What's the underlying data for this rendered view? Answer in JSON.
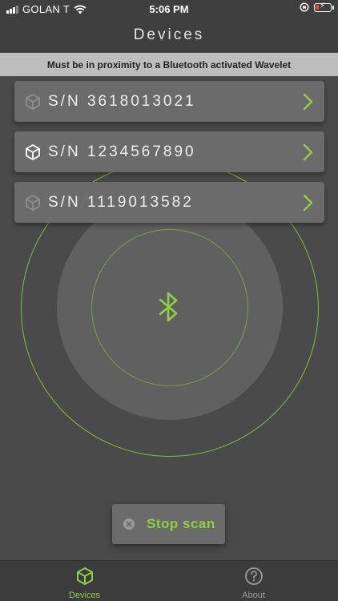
{
  "status_bar": {
    "carrier": "GOLAN T",
    "time": "5:06 PM"
  },
  "header": {
    "title": "Devices"
  },
  "notice": {
    "text": "Must be in proximity to a Bluetooth activated Wavelet"
  },
  "devices": [
    {
      "serial": "S/N  3618013021",
      "icon": "cube-icon",
      "highlighted": false
    },
    {
      "serial": "S/N  1234567890",
      "icon": "cube-icon",
      "highlighted": true
    },
    {
      "serial": "S/N  1119013582",
      "icon": "cube-icon",
      "highlighted": false
    }
  ],
  "scan": {
    "stop_label": "Stop scan",
    "icon": "bluetooth-icon"
  },
  "tabbar": {
    "tabs": [
      {
        "label": "Devices",
        "icon": "cube-icon",
        "active": true
      },
      {
        "label": "About",
        "icon": "question-icon",
        "active": false
      }
    ]
  },
  "colors": {
    "accent": "#8cd13f",
    "background": "#4a4a4a",
    "header": "#3f3f3f",
    "card": "#6b6b6b",
    "notice": "#bdbdbd"
  }
}
